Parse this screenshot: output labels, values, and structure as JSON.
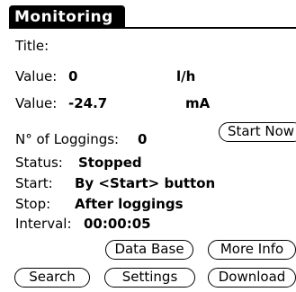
{
  "header": {
    "title": "Monitoring"
  },
  "fields": {
    "title_label": "Title:",
    "value1_label": "Value:",
    "value1_value": "0",
    "value1_unit": "l/h",
    "value2_label": "Value:",
    "value2_value": "-24.7",
    "value2_unit": "mA",
    "loggings_label": "N° of Loggings:",
    "loggings_value": "0",
    "status_label": "Status:",
    "status_value": "Stopped",
    "start_label": "Start:",
    "start_value": "By <Start> button",
    "stop_label": "Stop:",
    "stop_value": "After loggings",
    "interval_label": "Interval:",
    "interval_value": "00:00:05"
  },
  "buttons": {
    "start_now": "Start Now",
    "data_base": "Data Base",
    "more_info": "More Info",
    "search": "Search",
    "settings": "Settings",
    "download": "Download"
  }
}
